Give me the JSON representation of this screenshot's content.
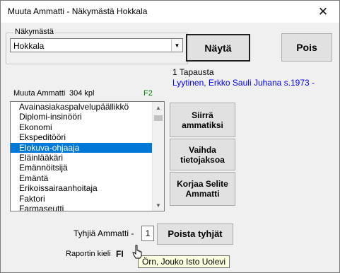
{
  "window": {
    "title": "Muuta Ammatti - Näkymästä Hokkala",
    "close_glyph": "✕"
  },
  "view_group": {
    "label": "Näkymästä",
    "combo": {
      "value": "Hokkala",
      "arrow_glyph": "▼"
    }
  },
  "buttons": {
    "show": "Näytä",
    "exit": "Pois",
    "move_to_occupation": "Siirrä ammatiksi",
    "change_period": "Vaihda tietojaksoa",
    "fix_explanation": "Korjaa Selite Ammatti",
    "remove_empty": "Poista tyhjät"
  },
  "case_info": {
    "count_label": "1 Tapausta",
    "person": "Lyytinen, Erkko Sauli Juhana s.1973 -"
  },
  "list_header": {
    "title": "Muuta Ammatti",
    "count": "304 kpl",
    "shortcut": "F2"
  },
  "occupations": {
    "items": [
      "Avainasiakaspalvelupäällikkö",
      "Diplomi-insinööri",
      "Ekonomi",
      "Ekspeditööri",
      "Elokuva-ohjaaja",
      "Eläinlääkäri",
      "Emännöitsijä",
      "Emäntä",
      "Erikoissairaanhoitaja",
      "Faktori",
      "Farmaseutti"
    ],
    "selected_index": 4
  },
  "scrollbar": {
    "up_glyph": "▲",
    "down_glyph": "▼"
  },
  "empty_occupations": {
    "label": "Tyhjiä Ammatti -",
    "value": "1"
  },
  "report_language": {
    "label": "Raportin kieli",
    "value": "FI"
  },
  "tooltip": {
    "text": "Örn, Jouko Isto Uolevi"
  },
  "colors": {
    "link_blue": "#0000ff",
    "shortcut_green": "#008000",
    "selection": "#0078d7"
  }
}
